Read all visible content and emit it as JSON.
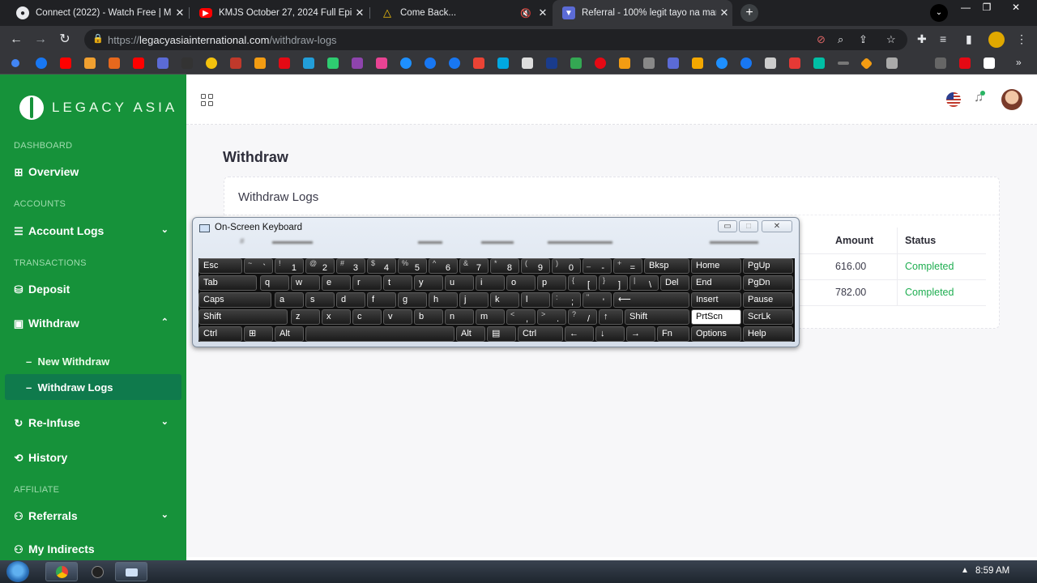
{
  "browser": {
    "tabs": [
      {
        "title": "Connect (2022) - Watch Free | M",
        "favicon_color": "#e8eaed",
        "favicon": "cast-icon"
      },
      {
        "title": "KMJS October 27, 2024 Full Episo",
        "favicon_color": "#ff0000",
        "favicon": "youtube-icon"
      },
      {
        "title": "Come Back...",
        "favicon_color": "#f4c20d",
        "favicon": "drive-icon"
      },
      {
        "title": "Referral - 100% legit tayo na mar",
        "favicon_color": "#5b6bd6",
        "favicon": "shield-icon"
      }
    ],
    "new_tab": "+",
    "tab_close": "✕",
    "url": {
      "scheme": "https://",
      "host": "legacyasiainternational.com",
      "path": "/withdraw-logs"
    }
  },
  "sidebar": {
    "brand": "LEGACY ASIA",
    "sections": {
      "dashboard": "DASHBOARD",
      "accounts": "ACCOUNTS",
      "transactions": "TRANSACTIONS",
      "affiliate": "AFFILIATE"
    },
    "items": {
      "overview": "Overview",
      "account_logs": "Account Logs",
      "deposit": "Deposit",
      "withdraw": "Withdraw",
      "new_withdraw": "New Withdraw",
      "withdraw_logs": "Withdraw Logs",
      "reinfuse": "Re-Infuse",
      "history": "History",
      "referrals": "Referrals",
      "my_indirects": "My Indirects"
    },
    "sub_marker": "–"
  },
  "main": {
    "page_title": "Withdraw",
    "card_title": "Withdraw Logs",
    "table": {
      "headers": {
        "amount": "Amount",
        "status": "Status"
      },
      "rows": [
        {
          "amount": "616.00",
          "status": "Completed"
        },
        {
          "amount": "782.00",
          "status": "Completed"
        }
      ]
    }
  },
  "osk": {
    "title": "On-Screen Keyboard",
    "rows": [
      [
        [
          "Esc",
          "",
          0,
          54
        ],
        [
          "`",
          "~",
          56,
          36
        ],
        [
          "1",
          "!",
          94,
          36
        ],
        [
          "2",
          "@",
          132,
          36
        ],
        [
          "3",
          "#",
          170,
          36
        ],
        [
          "4",
          "$",
          208,
          36
        ],
        [
          "5",
          "%",
          246,
          36
        ],
        [
          "6",
          "^",
          284,
          36
        ],
        [
          "7",
          "&",
          322,
          36
        ],
        [
          "8",
          "*",
          360,
          36
        ],
        [
          "9",
          "(",
          398,
          36
        ],
        [
          "0",
          ")",
          436,
          36
        ],
        [
          "-",
          "_",
          474,
          36
        ],
        [
          "=",
          "+",
          512,
          36
        ],
        [
          "Bksp",
          "",
          550,
          56
        ],
        [
          "Home",
          "",
          608,
          62
        ],
        [
          "PgUp",
          "",
          672,
          62
        ]
      ],
      [
        [
          "Tab",
          "",
          0,
          72
        ],
        [
          "q",
          "",
          76,
          36
        ],
        [
          "w",
          "",
          114,
          36
        ],
        [
          "e",
          "",
          152,
          36
        ],
        [
          "r",
          "",
          190,
          36
        ],
        [
          "t",
          "",
          228,
          36
        ],
        [
          "y",
          "",
          266,
          36
        ],
        [
          "u",
          "",
          304,
          36
        ],
        [
          "i",
          "",
          342,
          36
        ],
        [
          "o",
          "",
          380,
          36
        ],
        [
          "p",
          "",
          418,
          36
        ],
        [
          "[",
          "{",
          456,
          36
        ],
        [
          "]",
          "}",
          494,
          36
        ],
        [
          "\\",
          "|",
          532,
          36
        ],
        [
          "Del",
          "",
          570,
          36
        ],
        [
          "End",
          "",
          608,
          62
        ],
        [
          "PgDn",
          "",
          672,
          62
        ]
      ],
      [
        [
          "Caps",
          "",
          0,
          90
        ],
        [
          "a",
          "",
          94,
          36
        ],
        [
          "s",
          "",
          132,
          36
        ],
        [
          "d",
          "",
          170,
          36
        ],
        [
          "f",
          "",
          208,
          36
        ],
        [
          "g",
          "",
          246,
          36
        ],
        [
          "h",
          "",
          284,
          36
        ],
        [
          "j",
          "",
          322,
          36
        ],
        [
          "k",
          "",
          360,
          36
        ],
        [
          "l",
          "",
          398,
          36
        ],
        [
          ";",
          ":",
          436,
          36
        ],
        [
          "'",
          "\"",
          474,
          36
        ],
        [
          "⟵",
          "",
          512,
          94
        ],
        [
          "Insert",
          "",
          608,
          62
        ],
        [
          "Pause",
          "",
          672,
          62
        ]
      ],
      [
        [
          "Shift",
          "",
          0,
          110
        ],
        [
          "z",
          "",
          114,
          36
        ],
        [
          "x",
          "",
          152,
          36
        ],
        [
          "c",
          "",
          190,
          36
        ],
        [
          "v",
          "",
          228,
          36
        ],
        [
          "b",
          "",
          266,
          36
        ],
        [
          "n",
          "",
          304,
          36
        ],
        [
          "m",
          "",
          342,
          36
        ],
        [
          ",",
          "<",
          380,
          36
        ],
        [
          ".",
          ">",
          418,
          36
        ],
        [
          "/",
          "?",
          456,
          36
        ],
        [
          "↑",
          "",
          494,
          30
        ],
        [
          "Shift",
          "",
          526,
          80
        ],
        [
          "PrtScn",
          "",
          608,
          62
        ],
        [
          "ScrLk",
          "",
          672,
          62
        ]
      ],
      [
        [
          "Ctrl",
          "",
          0,
          54
        ],
        [
          "⊞",
          "",
          56,
          36
        ],
        [
          "Alt",
          "",
          94,
          36
        ],
        [
          "",
          "",
          132,
          184
        ],
        [
          "Alt",
          "",
          318,
          36
        ],
        [
          "▤",
          "",
          356,
          36
        ],
        [
          "Ctrl",
          "",
          394,
          56
        ],
        [
          "←",
          "",
          452,
          36
        ],
        [
          "↓",
          "",
          490,
          36
        ],
        [
          "→",
          "",
          528,
          36
        ],
        [
          "Fn",
          "",
          566,
          40
        ],
        [
          "Options",
          "",
          608,
          62
        ],
        [
          "Help",
          "",
          672,
          62
        ]
      ]
    ],
    "lit_key": "PrtScn"
  },
  "taskbar": {
    "clock": "8:59 AM",
    "tray_arrow": "▲"
  },
  "colors": {
    "sidebar": "#16923a",
    "active_sub": "#0f7a4c",
    "status_ok": "#1fae51"
  }
}
